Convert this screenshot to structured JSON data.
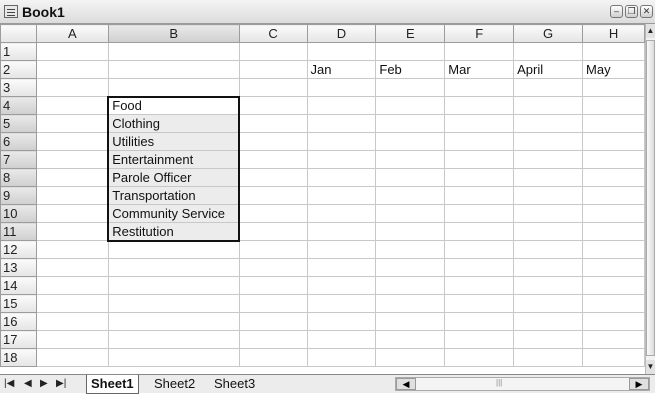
{
  "window": {
    "title": "Book1"
  },
  "columns": [
    "A",
    "B",
    "C",
    "D",
    "E",
    "F",
    "G",
    "H"
  ],
  "rows": [
    "1",
    "2",
    "3",
    "4",
    "5",
    "6",
    "7",
    "8",
    "9",
    "10",
    "11",
    "12",
    "13",
    "14",
    "15",
    "16",
    "17",
    "18"
  ],
  "cells": {
    "D2": "Jan",
    "E2": "Feb",
    "F2": "Mar",
    "G2": "April",
    "H2": "May",
    "B4": "Food",
    "B5": "Clothing",
    "B6": "Utilities",
    "B7": "Entertainment",
    "B8": "Parole Officer",
    "B9": "Transportation",
    "B10": "Community Service",
    "B11": "Restitution"
  },
  "selection": {
    "range": "B4:B11",
    "column": "B",
    "rows": [
      "4",
      "5",
      "6",
      "7",
      "8",
      "9",
      "10",
      "11"
    ]
  },
  "sheets": [
    {
      "name": "Sheet1",
      "active": true
    },
    {
      "name": "Sheet2",
      "active": false
    },
    {
      "name": "Sheet3",
      "active": false
    }
  ],
  "icons": {
    "first": "first-sheet-icon",
    "prev": "prev-sheet-icon",
    "next": "next-sheet-icon",
    "last": "last-sheet-icon"
  }
}
